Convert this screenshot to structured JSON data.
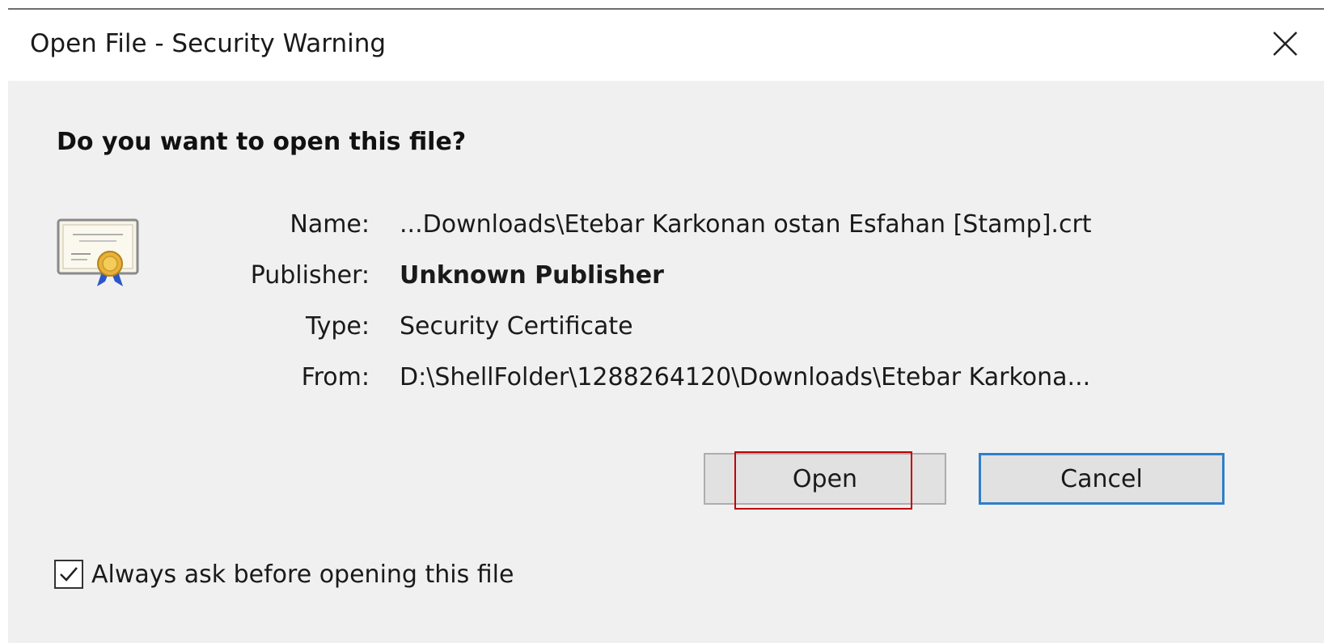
{
  "window": {
    "title": "Open File - Security Warning",
    "close_icon": "close-icon"
  },
  "prompt": {
    "question": "Do you want to open this file?"
  },
  "file_info": {
    "icon": "certificate-icon",
    "name_label": "Name:",
    "name_value": "...Downloads\\Etebar Karkonan ostan Esfahan [Stamp].crt",
    "publisher_label": "Publisher:",
    "publisher_value": "Unknown Publisher",
    "type_label": "Type:",
    "type_value": "Security Certificate",
    "from_label": "From:",
    "from_value": "D:\\ShellFolder\\1288264120\\Downloads\\Etebar Karkona..."
  },
  "buttons": {
    "open_label": "Open",
    "cancel_label": "Cancel"
  },
  "options": {
    "always_ask_label": "Always ask before opening this file",
    "always_ask_checked": true
  },
  "colors": {
    "dialog_background": "#f0f0f0",
    "highlight_box": "#c00000",
    "default_button_border": "#2f7fc8"
  }
}
